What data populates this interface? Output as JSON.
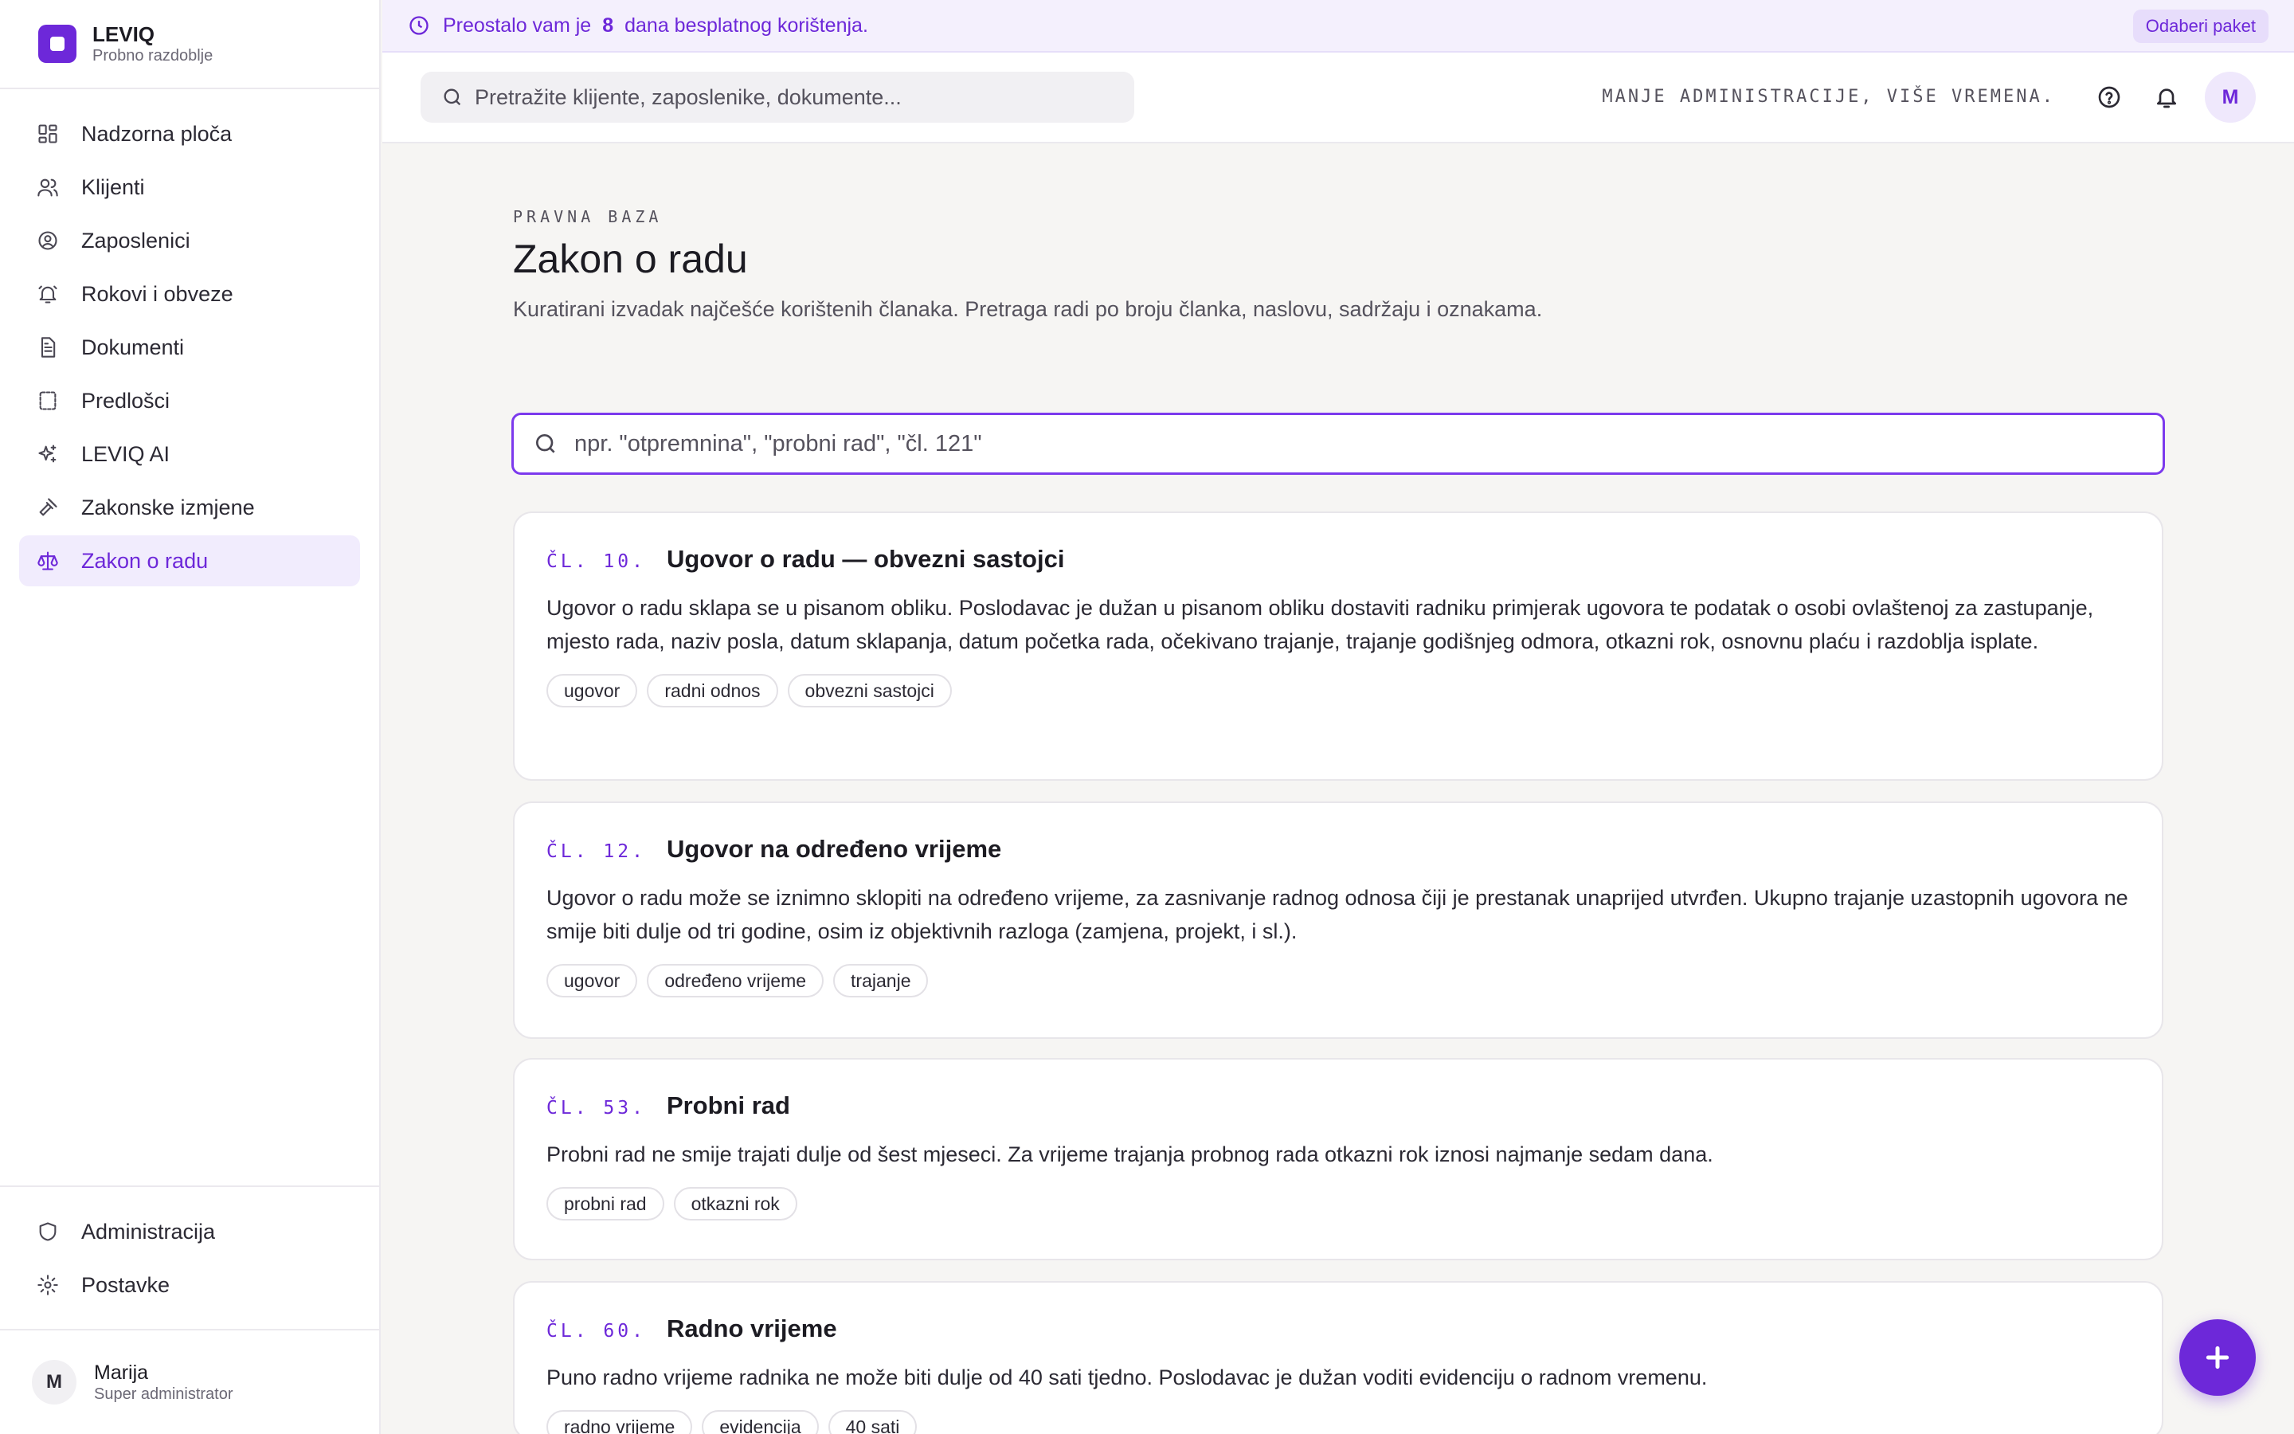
{
  "brand": {
    "name": "LEVIQ",
    "subtitle": "Probno razdoblje"
  },
  "sidebar": {
    "items": [
      {
        "label": "Nadzorna ploča",
        "icon": "dashboard-icon",
        "active": false
      },
      {
        "label": "Klijenti",
        "icon": "users-icon",
        "active": false
      },
      {
        "label": "Zaposlenici",
        "icon": "user-circle-icon",
        "active": false
      },
      {
        "label": "Rokovi i obveze",
        "icon": "bell-icon",
        "active": false
      },
      {
        "label": "Dokumenti",
        "icon": "document-icon",
        "active": false
      },
      {
        "label": "Predlošci",
        "icon": "template-icon",
        "active": false
      },
      {
        "label": "LEVIQ AI",
        "icon": "sparkles-icon",
        "active": false
      },
      {
        "label": "Zakonske izmjene",
        "icon": "gavel-icon",
        "active": false
      },
      {
        "label": "Zakon o radu",
        "icon": "scale-icon",
        "active": true
      }
    ],
    "bottom": [
      {
        "label": "Administracija",
        "icon": "shield-icon"
      },
      {
        "label": "Postavke",
        "icon": "gear-icon"
      }
    ],
    "user": {
      "initial": "M",
      "name": "Marija",
      "role": "Super administrator"
    }
  },
  "trial": {
    "prefix": "Preostalo vam je",
    "days": "8",
    "suffix": "dana besplatnog korištenja.",
    "button": "Odaberi paket"
  },
  "topbar": {
    "search_placeholder": "Pretražite klijente, zaposlenike, dokumente...",
    "tagline": "MANJE ADMINISTRACIJE, VIŠE VREMENA.",
    "avatar_initial": "M"
  },
  "page": {
    "eyebrow": "PRAVNA BAZA",
    "title": "Zakon o radu",
    "subtitle": "Kuratirani izvadak najčešće korištenih članaka. Pretraga radi po broju članka, naslovu, sadržaju i oznakama.",
    "search_placeholder": "npr. \"otpremnina\", \"probni rad\", \"čl. 121\""
  },
  "articles": [
    {
      "number": "ČL. 10.",
      "title": "Ugovor o radu — obvezni sastojci",
      "body": "Ugovor o radu sklapa se u pisanom obliku. Poslodavac je dužan u pisanom obliku dostaviti radniku primjerak ugovora te podatak o osobi ovlaštenoj za zastupanje, mjesto rada, naziv posla, datum sklapanja, datum početka rada, očekivano trajanje, trajanje godišnjeg odmora, otkazni rok, osnovnu plaću i razdoblja isplate.",
      "tags": [
        "ugovor",
        "radni odnos",
        "obvezni sastojci"
      ]
    },
    {
      "number": "ČL. 12.",
      "title": "Ugovor na određeno vrijeme",
      "body": "Ugovor o radu može se iznimno sklopiti na određeno vrijeme, za zasnivanje radnog odnosa čiji je prestanak unaprijed utvrđen. Ukupno trajanje uzastopnih ugovora ne smije biti dulje od tri godine, osim iz objektivnih razloga (zamjena, projekt, i sl.).",
      "tags": [
        "ugovor",
        "određeno vrijeme",
        "trajanje"
      ]
    },
    {
      "number": "ČL. 53.",
      "title": "Probni rad",
      "body": "Probni rad ne smije trajati dulje od šest mjeseci. Za vrijeme trajanja probnog rada otkazni rok iznosi najmanje sedam dana.",
      "tags": [
        "probni rad",
        "otkazni rok"
      ]
    },
    {
      "number": "ČL. 60.",
      "title": "Radno vrijeme",
      "body": "Puno radno vrijeme radnika ne može biti dulje od 40 sati tjedno. Poslodavac je dužan voditi evidenciju o radnom vremenu.",
      "tags": [
        "radno vrijeme",
        "evidencija",
        "40 sati"
      ]
    }
  ],
  "colors": {
    "accent": "#6d28d9",
    "active_bg": "#f1ecfd",
    "banner_bg": "#f4f0fd"
  }
}
